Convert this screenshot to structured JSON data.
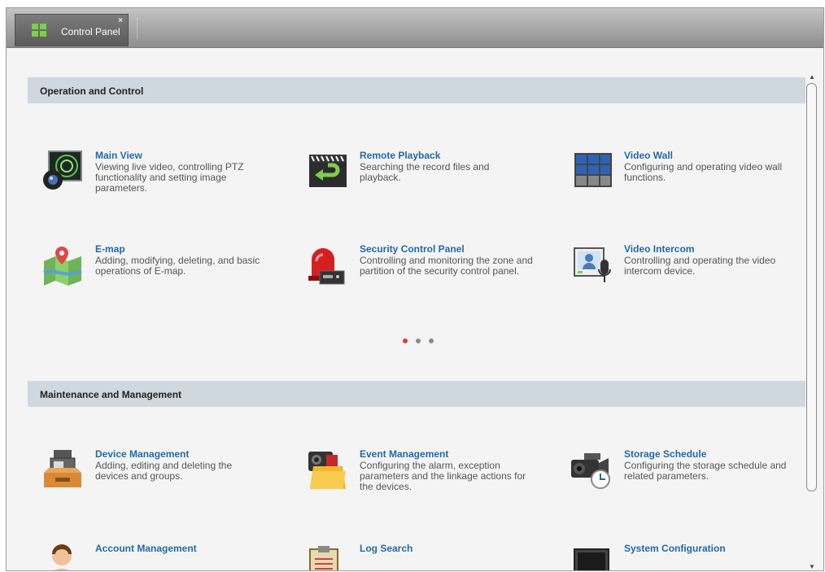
{
  "tab": {
    "label": "Control Panel",
    "close": "×"
  },
  "sections": [
    {
      "title": "Operation and Control",
      "items": [
        {
          "title": "Main View",
          "desc": "Viewing live video, controlling PTZ functionality and setting image parameters.",
          "icon": "main-view-icon"
        },
        {
          "title": "Remote Playback",
          "desc": "Searching the record files and playback.",
          "icon": "remote-playback-icon"
        },
        {
          "title": "Video Wall",
          "desc": "Configuring and operating video wall functions.",
          "icon": "video-wall-icon"
        },
        {
          "title": "E-map",
          "desc": "Adding, modifying, deleting, and basic operations of E-map.",
          "icon": "emap-icon"
        },
        {
          "title": "Security Control Panel",
          "desc": "Controlling and monitoring the zone and partition of the security control panel.",
          "icon": "alarm-siren-icon"
        },
        {
          "title": "Video Intercom",
          "desc": "Controlling and operating the video intercom device.",
          "icon": "video-intercom-icon"
        }
      ]
    },
    {
      "title": "Maintenance and Management",
      "items": [
        {
          "title": "Device Management",
          "desc": "Adding, editing and deleting the devices and groups.",
          "icon": "device-management-icon"
        },
        {
          "title": "Event Management",
          "desc": "Configuring the alarm, exception parameters and the linkage actions for the devices.",
          "icon": "event-management-icon"
        },
        {
          "title": "Storage Schedule",
          "desc": "Configuring the storage schedule and related parameters.",
          "icon": "storage-schedule-icon"
        },
        {
          "title": "Account Management",
          "desc": "",
          "icon": "account-icon"
        },
        {
          "title": "Log Search",
          "desc": "",
          "icon": "log-search-icon"
        },
        {
          "title": "System Configuration",
          "desc": "",
          "icon": "system-config-icon"
        }
      ]
    }
  ],
  "pagination": {
    "pages": 3,
    "active": 1,
    "active_color": "#e23b3b",
    "inactive_color": "#8a8a8a"
  },
  "colors": {
    "title_link": "#2469a6",
    "section_bg": "#cfd8de",
    "tabbar": "#9e9e9e"
  }
}
